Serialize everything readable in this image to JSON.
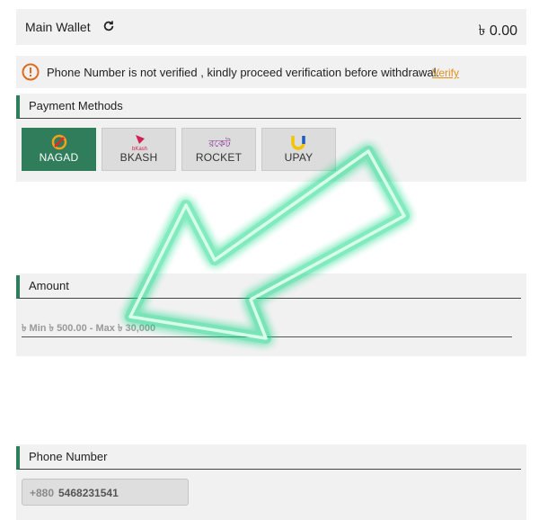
{
  "wallet": {
    "label": "Main Wallet",
    "amount": "৳ 0.00",
    "refresh_icon": "refresh-icon"
  },
  "notice": {
    "icon": "warning-icon",
    "message": "Phone Number is not verified , kindly proceed verification before withdrawal.",
    "link": "Verify"
  },
  "payment": {
    "title": "Payment Methods",
    "methods": [
      {
        "label": "NAGAD",
        "active": true,
        "icon": "nagad-logo",
        "logo_text": ""
      },
      {
        "label": "BKASH",
        "active": false,
        "icon": "bkash-logo",
        "logo_text": "bKash"
      },
      {
        "label": "ROCKET",
        "active": false,
        "icon": "rocket-logo",
        "logo_text": "রকেট"
      },
      {
        "label": "UPAY",
        "active": false,
        "icon": "upay-logo",
        "logo_text": ""
      }
    ]
  },
  "amount": {
    "title": "Amount",
    "range_text": "৳ Min ৳ 500.00 - Max ৳ 30,000"
  },
  "phone": {
    "title": "Phone Number",
    "prefix": "+880",
    "value": "5468231541"
  },
  "overlay": {
    "icon": "arrow-icon",
    "color": "#1fd98a"
  },
  "colors": {
    "accent": "#2f7d5b",
    "link": "#e0901c",
    "warning": "#e06a1c"
  }
}
